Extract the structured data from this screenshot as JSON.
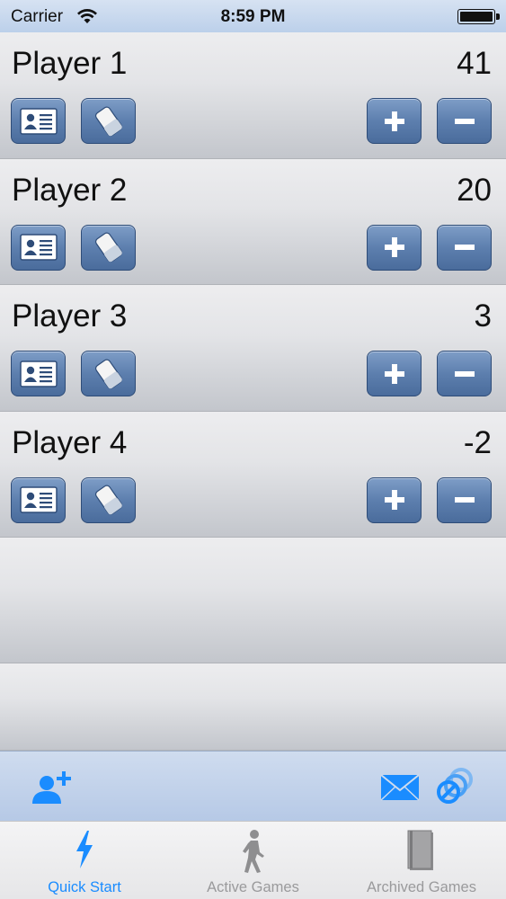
{
  "status_bar": {
    "carrier": "Carrier",
    "time": "8:59 PM"
  },
  "players": [
    {
      "name": "Player 1",
      "score": "41"
    },
    {
      "name": "Player 2",
      "score": "20"
    },
    {
      "name": "Player 3",
      "score": "3"
    },
    {
      "name": "Player 4",
      "score": "-2"
    }
  ],
  "row_buttons": {
    "card_icon": "contact-card-icon",
    "eraser_icon": "eraser-icon",
    "plus_icon": "plus-icon",
    "minus_icon": "minus-icon"
  },
  "toolbar": {
    "add_player_icon": "add-player-icon",
    "email_icon": "mail-icon",
    "link_icon": "link-icon"
  },
  "tabs": [
    {
      "label": "Quick Start",
      "icon": "lightning-icon",
      "active": true
    },
    {
      "label": "Active Games",
      "icon": "walking-person-icon",
      "active": false
    },
    {
      "label": "Archived Games",
      "icon": "book-icon",
      "active": false
    }
  ],
  "colors": {
    "accent": "#1a8cff",
    "button_blue": "#5d7fae",
    "toolbar_blue": "#c3d4ec",
    "inactive_tab": "#9a9a9c"
  }
}
